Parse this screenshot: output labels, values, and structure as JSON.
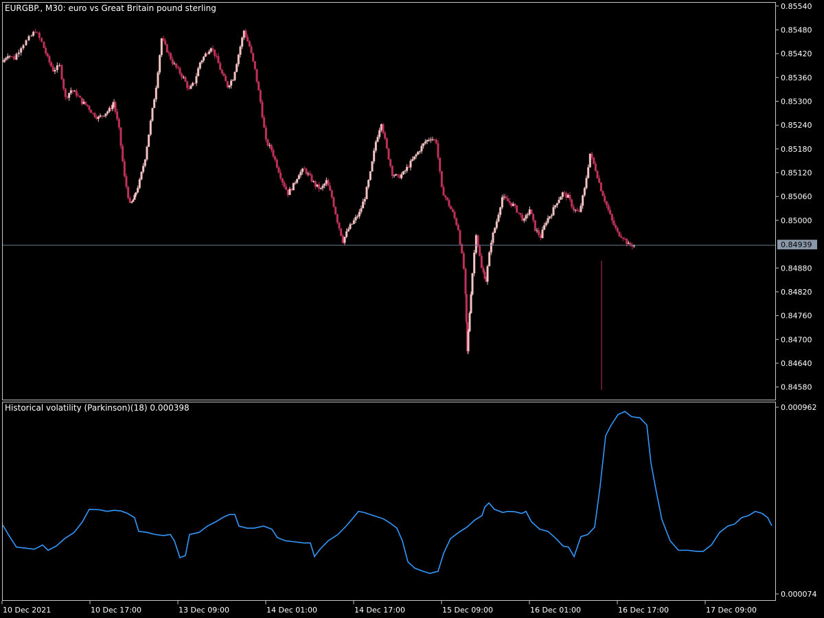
{
  "main_title": "EURGBP., M30:  euro vs Great Britain pound sterling",
  "sub_title": "Historical volatility (Parkinson)(18) 0.000398",
  "colors": {
    "background": "#000000",
    "grid": "#c8c8c8",
    "bull_candle": "#f4c4c4",
    "bear_candle": "#c0305a",
    "doji": "#22aa22",
    "volatility_line": "#3399ff",
    "current_price_line": "#6e7a8a",
    "price_tag_bg": "#8a97a8"
  },
  "chart_data": [
    {
      "type": "candlestick",
      "title": "EURGBP., M30:  euro vs Great Britain pound sterling",
      "y_ticks": [
        "0.85540",
        "0.85480",
        "0.85420",
        "0.85360",
        "0.85300",
        "0.85240",
        "0.85180",
        "0.85120",
        "0.85060",
        "0.85000",
        "0.84880",
        "0.84820",
        "0.84760",
        "0.84700",
        "0.84640",
        "0.84580"
      ],
      "ylim": [
        0.8455,
        0.8555
      ],
      "current_price": "0.84939",
      "x_ticks": [
        "10 Dec 2021",
        "10 Dec 17:00",
        "13 Dec 09:00",
        "14 Dec 01:00",
        "14 Dec 17:00",
        "15 Dec 09:00",
        "16 Dec 01:00",
        "16 Dec 17:00",
        "17 Dec 09:00"
      ],
      "close_path": [
        {
          "x": 0,
          "y": 0.854
        },
        {
          "x": 8,
          "y": 0.8542
        },
        {
          "x": 18,
          "y": 0.8541
        },
        {
          "x": 28,
          "y": 0.8544
        },
        {
          "x": 40,
          "y": 0.8546
        },
        {
          "x": 48,
          "y": 0.8548
        },
        {
          "x": 58,
          "y": 0.8545
        },
        {
          "x": 66,
          "y": 0.8541
        },
        {
          "x": 74,
          "y": 0.8538
        },
        {
          "x": 84,
          "y": 0.8539
        },
        {
          "x": 92,
          "y": 0.8531
        },
        {
          "x": 100,
          "y": 0.8533
        },
        {
          "x": 108,
          "y": 0.8532
        },
        {
          "x": 116,
          "y": 0.853
        },
        {
          "x": 124,
          "y": 0.8529
        },
        {
          "x": 132,
          "y": 0.8527
        },
        {
          "x": 140,
          "y": 0.8526
        },
        {
          "x": 148,
          "y": 0.8527
        },
        {
          "x": 156,
          "y": 0.8528
        },
        {
          "x": 162,
          "y": 0.853
        },
        {
          "x": 170,
          "y": 0.8523
        },
        {
          "x": 178,
          "y": 0.8511
        },
        {
          "x": 186,
          "y": 0.8504
        },
        {
          "x": 192,
          "y": 0.8506
        },
        {
          "x": 200,
          "y": 0.851
        },
        {
          "x": 208,
          "y": 0.8516
        },
        {
          "x": 216,
          "y": 0.8525
        },
        {
          "x": 224,
          "y": 0.8534
        },
        {
          "x": 232,
          "y": 0.8546
        },
        {
          "x": 240,
          "y": 0.8543
        },
        {
          "x": 248,
          "y": 0.854
        },
        {
          "x": 256,
          "y": 0.8538
        },
        {
          "x": 264,
          "y": 0.8536
        },
        {
          "x": 272,
          "y": 0.8533
        },
        {
          "x": 280,
          "y": 0.8535
        },
        {
          "x": 288,
          "y": 0.854
        },
        {
          "x": 296,
          "y": 0.8542
        },
        {
          "x": 304,
          "y": 0.8544
        },
        {
          "x": 312,
          "y": 0.8541
        },
        {
          "x": 320,
          "y": 0.8537
        },
        {
          "x": 328,
          "y": 0.8534
        },
        {
          "x": 336,
          "y": 0.8536
        },
        {
          "x": 344,
          "y": 0.8542
        },
        {
          "x": 352,
          "y": 0.8548
        },
        {
          "x": 360,
          "y": 0.8544
        },
        {
          "x": 368,
          "y": 0.8538
        },
        {
          "x": 376,
          "y": 0.853
        },
        {
          "x": 384,
          "y": 0.852
        },
        {
          "x": 392,
          "y": 0.8518
        },
        {
          "x": 400,
          "y": 0.8514
        },
        {
          "x": 408,
          "y": 0.851
        },
        {
          "x": 416,
          "y": 0.8507
        },
        {
          "x": 424,
          "y": 0.8509
        },
        {
          "x": 432,
          "y": 0.8512
        },
        {
          "x": 440,
          "y": 0.8513
        },
        {
          "x": 448,
          "y": 0.8511
        },
        {
          "x": 456,
          "y": 0.8509
        },
        {
          "x": 464,
          "y": 0.8508
        },
        {
          "x": 472,
          "y": 0.851
        },
        {
          "x": 480,
          "y": 0.8506
        },
        {
          "x": 488,
          "y": 0.85
        },
        {
          "x": 496,
          "y": 0.8495
        },
        {
          "x": 504,
          "y": 0.8498
        },
        {
          "x": 512,
          "y": 0.85
        },
        {
          "x": 520,
          "y": 0.8502
        },
        {
          "x": 528,
          "y": 0.8506
        },
        {
          "x": 536,
          "y": 0.8512
        },
        {
          "x": 544,
          "y": 0.852
        },
        {
          "x": 552,
          "y": 0.8525
        },
        {
          "x": 560,
          "y": 0.8518
        },
        {
          "x": 568,
          "y": 0.8512
        },
        {
          "x": 576,
          "y": 0.8511
        },
        {
          "x": 584,
          "y": 0.8512
        },
        {
          "x": 592,
          "y": 0.8514
        },
        {
          "x": 600,
          "y": 0.8516
        },
        {
          "x": 608,
          "y": 0.8518
        },
        {
          "x": 616,
          "y": 0.852
        },
        {
          "x": 624,
          "y": 0.8521
        },
        {
          "x": 632,
          "y": 0.852
        },
        {
          "x": 640,
          "y": 0.8508
        },
        {
          "x": 648,
          "y": 0.8505
        },
        {
          "x": 656,
          "y": 0.8502
        },
        {
          "x": 664,
          "y": 0.8498
        },
        {
          "x": 672,
          "y": 0.8488
        },
        {
          "x": 676,
          "y": 0.8467
        },
        {
          "x": 682,
          "y": 0.8482
        },
        {
          "x": 690,
          "y": 0.8497
        },
        {
          "x": 698,
          "y": 0.8488
        },
        {
          "x": 704,
          "y": 0.8485
        },
        {
          "x": 712,
          "y": 0.8495
        },
        {
          "x": 720,
          "y": 0.85
        },
        {
          "x": 728,
          "y": 0.8506
        },
        {
          "x": 736,
          "y": 0.8505
        },
        {
          "x": 744,
          "y": 0.8504
        },
        {
          "x": 752,
          "y": 0.8502
        },
        {
          "x": 760,
          "y": 0.85
        },
        {
          "x": 768,
          "y": 0.8503
        },
        {
          "x": 776,
          "y": 0.8498
        },
        {
          "x": 784,
          "y": 0.8496
        },
        {
          "x": 792,
          "y": 0.85
        },
        {
          "x": 800,
          "y": 0.8502
        },
        {
          "x": 808,
          "y": 0.8505
        },
        {
          "x": 816,
          "y": 0.8507
        },
        {
          "x": 824,
          "y": 0.8506
        },
        {
          "x": 832,
          "y": 0.8503
        },
        {
          "x": 840,
          "y": 0.8502
        },
        {
          "x": 848,
          "y": 0.8508
        },
        {
          "x": 856,
          "y": 0.8517
        },
        {
          "x": 864,
          "y": 0.8513
        },
        {
          "x": 872,
          "y": 0.8508
        },
        {
          "x": 880,
          "y": 0.8504
        },
        {
          "x": 888,
          "y": 0.85
        },
        {
          "x": 896,
          "y": 0.8497
        },
        {
          "x": 904,
          "y": 0.8496
        },
        {
          "x": 912,
          "y": 0.8494
        }
      ]
    },
    {
      "type": "line",
      "title": "Historical volatility (Parkinson)(18) 0.000398",
      "y_ticks": [
        "0.000962",
        "0.000074"
      ],
      "ylim": [
        7.4e-05,
        0.000962
      ],
      "series": [
        {
          "values": [
            {
              "x": 0,
              "y": 0.000405
            },
            {
              "x": 10,
              "y": 0.00035
            },
            {
              "x": 20,
              "y": 0.0003
            },
            {
              "x": 34,
              "y": 0.000295
            },
            {
              "x": 46,
              "y": 0.00029
            },
            {
              "x": 58,
              "y": 0.00031
            },
            {
              "x": 66,
              "y": 0.000285
            },
            {
              "x": 78,
              "y": 0.000305
            },
            {
              "x": 90,
              "y": 0.00034
            },
            {
              "x": 104,
              "y": 0.00037
            },
            {
              "x": 116,
              "y": 0.00042
            },
            {
              "x": 126,
              "y": 0.00048
            },
            {
              "x": 140,
              "y": 0.000478
            },
            {
              "x": 152,
              "y": 0.00047
            },
            {
              "x": 162,
              "y": 0.000475
            },
            {
              "x": 172,
              "y": 0.000472
            },
            {
              "x": 182,
              "y": 0.00046
            },
            {
              "x": 192,
              "y": 0.00044
            },
            {
              "x": 198,
              "y": 0.000375
            },
            {
              "x": 210,
              "y": 0.00037
            },
            {
              "x": 222,
              "y": 0.00036
            },
            {
              "x": 234,
              "y": 0.000355
            },
            {
              "x": 244,
              "y": 0.00036
            },
            {
              "x": 250,
              "y": 0.00033
            },
            {
              "x": 258,
              "y": 0.00025
            },
            {
              "x": 266,
              "y": 0.00026
            },
            {
              "x": 272,
              "y": 0.00036
            },
            {
              "x": 286,
              "y": 0.00037
            },
            {
              "x": 298,
              "y": 0.0004
            },
            {
              "x": 310,
              "y": 0.00042
            },
            {
              "x": 320,
              "y": 0.00044
            },
            {
              "x": 330,
              "y": 0.000455
            },
            {
              "x": 338,
              "y": 0.000455
            },
            {
              "x": 344,
              "y": 0.0004
            },
            {
              "x": 356,
              "y": 0.00039
            },
            {
              "x": 366,
              "y": 0.00039
            },
            {
              "x": 380,
              "y": 0.0004
            },
            {
              "x": 392,
              "y": 0.000385
            },
            {
              "x": 400,
              "y": 0.000345
            },
            {
              "x": 412,
              "y": 0.00033
            },
            {
              "x": 426,
              "y": 0.000325
            },
            {
              "x": 438,
              "y": 0.00032
            },
            {
              "x": 448,
              "y": 0.00032
            },
            {
              "x": 454,
              "y": 0.000255
            },
            {
              "x": 462,
              "y": 0.00029
            },
            {
              "x": 474,
              "y": 0.00033
            },
            {
              "x": 488,
              "y": 0.00036
            },
            {
              "x": 500,
              "y": 0.0004
            },
            {
              "x": 508,
              "y": 0.00043
            },
            {
              "x": 518,
              "y": 0.00047
            },
            {
              "x": 526,
              "y": 0.000465
            },
            {
              "x": 540,
              "y": 0.00045
            },
            {
              "x": 554,
              "y": 0.000435
            },
            {
              "x": 564,
              "y": 0.000415
            },
            {
              "x": 574,
              "y": 0.00039
            },
            {
              "x": 582,
              "y": 0.00033
            },
            {
              "x": 590,
              "y": 0.00023
            },
            {
              "x": 600,
              "y": 0.0002
            },
            {
              "x": 612,
              "y": 0.000185
            },
            {
              "x": 622,
              "y": 0.000175
            },
            {
              "x": 634,
              "y": 0.000185
            },
            {
              "x": 642,
              "y": 0.00027
            },
            {
              "x": 652,
              "y": 0.00034
            },
            {
              "x": 664,
              "y": 0.00037
            },
            {
              "x": 676,
              "y": 0.000395
            },
            {
              "x": 688,
              "y": 0.00043
            },
            {
              "x": 698,
              "y": 0.00045
            },
            {
              "x": 702,
              "y": 0.00049
            },
            {
              "x": 708,
              "y": 0.00051
            },
            {
              "x": 716,
              "y": 0.00048
            },
            {
              "x": 728,
              "y": 0.000465
            },
            {
              "x": 736,
              "y": 0.00047
            },
            {
              "x": 746,
              "y": 0.000468
            },
            {
              "x": 756,
              "y": 0.00046
            },
            {
              "x": 762,
              "y": 0.00047
            },
            {
              "x": 770,
              "y": 0.00042
            },
            {
              "x": 782,
              "y": 0.000385
            },
            {
              "x": 794,
              "y": 0.000375
            },
            {
              "x": 806,
              "y": 0.00034
            },
            {
              "x": 816,
              "y": 0.000305
            },
            {
              "x": 824,
              "y": 0.0003
            },
            {
              "x": 832,
              "y": 0.000255
            },
            {
              "x": 842,
              "y": 0.00035
            },
            {
              "x": 852,
              "y": 0.00036
            },
            {
              "x": 862,
              "y": 0.000395
            },
            {
              "x": 870,
              "y": 0.00059
            },
            {
              "x": 878,
              "y": 0.00083
            },
            {
              "x": 886,
              "y": 0.00088
            },
            {
              "x": 896,
              "y": 0.00093
            },
            {
              "x": 906,
              "y": 0.000945
            },
            {
              "x": 916,
              "y": 0.00092
            },
            {
              "x": 928,
              "y": 0.000915
            },
            {
              "x": 938,
              "y": 0.00088
            },
            {
              "x": 944,
              "y": 0.0007
            },
            {
              "x": 952,
              "y": 0.00056
            },
            {
              "x": 960,
              "y": 0.00043
            },
            {
              "x": 972,
              "y": 0.00033
            },
            {
              "x": 984,
              "y": 0.000285
            },
            {
              "x": 998,
              "y": 0.000285
            },
            {
              "x": 1010,
              "y": 0.00028
            },
            {
              "x": 1020,
              "y": 0.00028
            },
            {
              "x": 1032,
              "y": 0.00031
            },
            {
              "x": 1044,
              "y": 0.00037
            },
            {
              "x": 1056,
              "y": 0.0004
            },
            {
              "x": 1066,
              "y": 0.00041
            },
            {
              "x": 1076,
              "y": 0.00044
            },
            {
              "x": 1086,
              "y": 0.00045
            },
            {
              "x": 1096,
              "y": 0.00047
            },
            {
              "x": 1106,
              "y": 0.00046
            },
            {
              "x": 1114,
              "y": 0.00044
            },
            {
              "x": 1120,
              "y": 0.000402
            }
          ]
        }
      ]
    }
  ]
}
